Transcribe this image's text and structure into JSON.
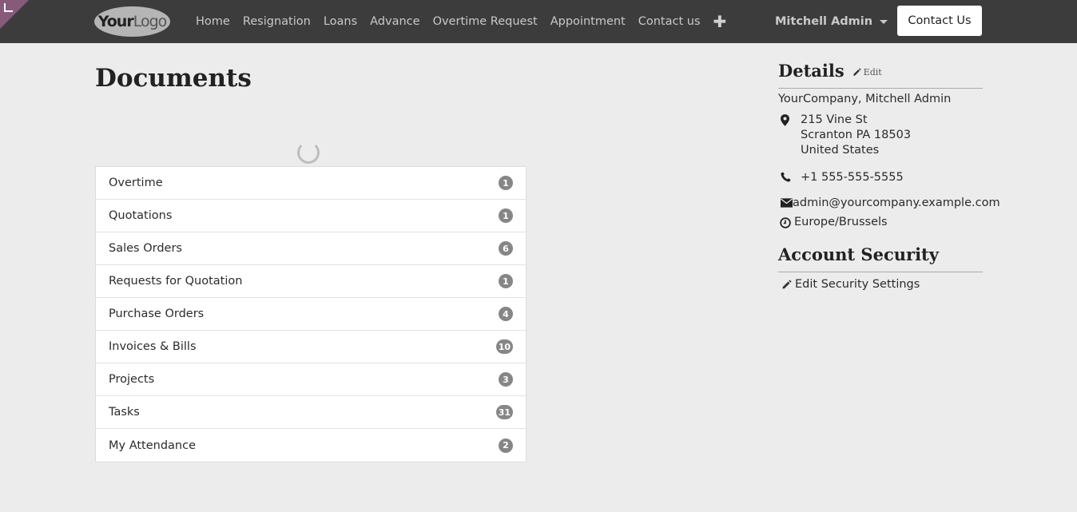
{
  "navbar": {
    "logo": {
      "bold": "Your",
      "light": "Logo"
    },
    "links": [
      "Home",
      "Resignation",
      "Loans",
      "Advance",
      "Overtime Request",
      "Appointment",
      "Contact us"
    ],
    "plus_label": "✚",
    "user_name": "Mitchell Admin",
    "contact_button": "Contact Us"
  },
  "main": {
    "title": "Documents",
    "documents": [
      {
        "label": "Overtime",
        "count": "1"
      },
      {
        "label": "Quotations",
        "count": "1"
      },
      {
        "label": "Sales Orders",
        "count": "6"
      },
      {
        "label": "Requests for Quotation",
        "count": "1"
      },
      {
        "label": "Purchase Orders",
        "count": "4"
      },
      {
        "label": "Invoices & Bills",
        "count": "10"
      },
      {
        "label": "Projects",
        "count": "3"
      },
      {
        "label": "Tasks",
        "count": "31"
      },
      {
        "label": "My Attendance",
        "count": "2"
      }
    ]
  },
  "details": {
    "title": "Details",
    "edit_label": "Edit",
    "company_user": "YourCompany, Mitchell Admin",
    "address_line1": "215 Vine St",
    "address_line2": "Scranton PA 18503",
    "address_line3": "United States",
    "phone": "+1 555-555-5555",
    "email": "admin@yourcompany.example.com",
    "timezone": "Europe/Brussels"
  },
  "security": {
    "title": "Account Security",
    "edit_settings": "Edit Security Settings"
  },
  "colors": {
    "navbar": "#3c3c3c",
    "corner": "#875a7b",
    "badge": "#868686",
    "background": "#ececec"
  }
}
